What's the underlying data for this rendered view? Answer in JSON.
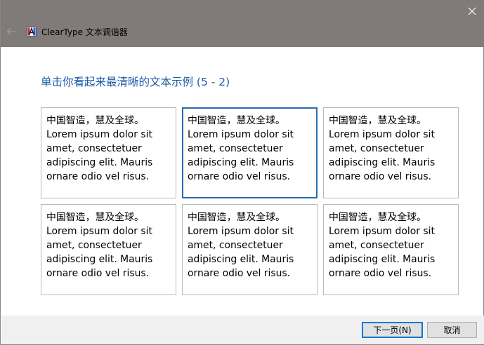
{
  "window": {
    "title": "ClearType 文本调谐器",
    "icon": "cleartype-app-icon",
    "close_icon": "close-icon",
    "back_icon": "back-arrow-icon"
  },
  "heading": "单击你看起来最清晰的文本示例 (5 - 2)",
  "samples": [
    {
      "lines": [
        "中国智造，慧及全球。",
        "Lorem ipsum dolor sit",
        "amet, consectetuer",
        "adipiscing elit. Mauris",
        "ornare odio vel risus."
      ],
      "selected": false
    },
    {
      "lines": [
        "中国智造，慧及全球。",
        "Lorem ipsum dolor sit",
        "amet, consectetuer",
        "adipiscing elit. Mauris",
        "ornare odio vel risus."
      ],
      "selected": true
    },
    {
      "lines": [
        "中国智造，慧及全球。",
        "Lorem ipsum dolor sit",
        "amet, consectetuer",
        "adipiscing elit. Mauris",
        "ornare odio vel risus."
      ],
      "selected": false
    },
    {
      "lines": [
        "中国智造，慧及全球。",
        "Lorem ipsum dolor sit",
        "amet, consectetuer",
        "adipiscing elit. Mauris",
        "ornare odio vel risus."
      ],
      "selected": false
    },
    {
      "lines": [
        "中国智造，慧及全球。",
        "Lorem ipsum dolor sit",
        "amet, consectetuer",
        "adipiscing elit. Mauris",
        "ornare odio vel risus."
      ],
      "selected": false
    },
    {
      "lines": [
        "中国智造，慧及全球。",
        "Lorem ipsum dolor sit",
        "amet, consectetuer",
        "adipiscing elit. Mauris",
        "ornare odio vel risus."
      ],
      "selected": false
    }
  ],
  "buttons": {
    "next": "下一页(N)",
    "cancel": "取消"
  },
  "colors": {
    "titlebar": "#807a79",
    "heading": "#1d5aa7",
    "selected_border": "#2a6bb3",
    "default_button_border": "#0078d7"
  }
}
